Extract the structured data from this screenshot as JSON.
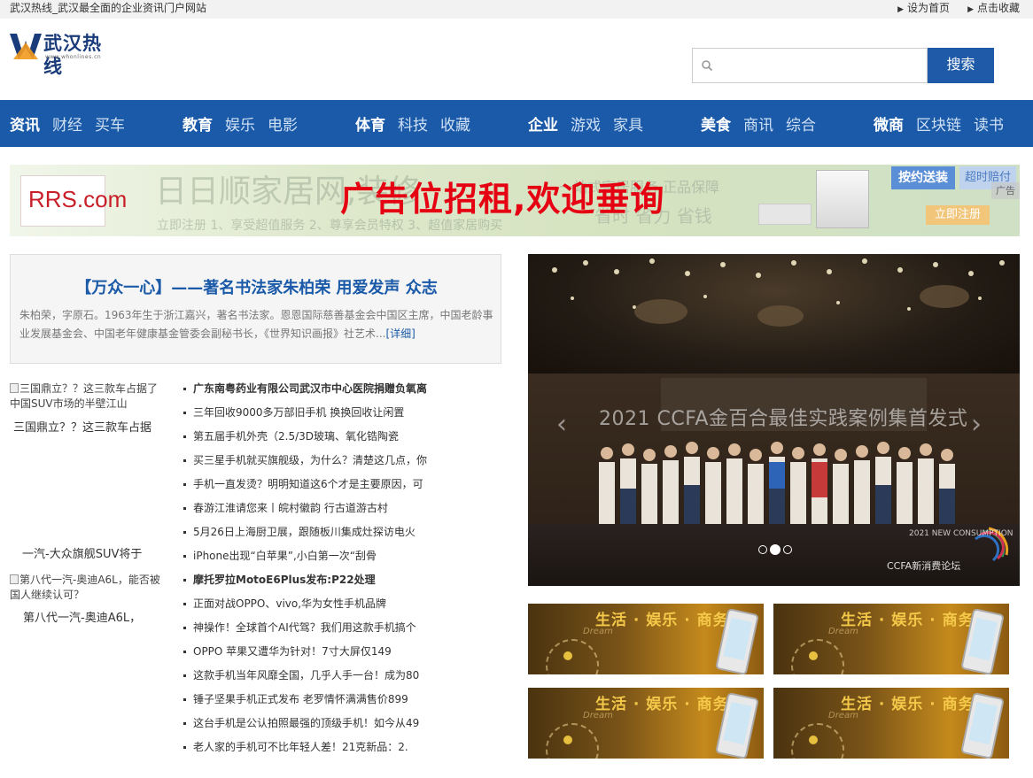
{
  "topbar": {
    "site_title": "武汉热线_武汉最全面的企业资讯门户网站",
    "set_home": "设为首页",
    "bookmark": "点击收藏"
  },
  "logo": {
    "name": "武汉热线",
    "url_text": "www.whonlines.cn"
  },
  "search": {
    "placeholder": "",
    "button": "搜索"
  },
  "nav": {
    "groups": [
      [
        "资讯",
        "财经",
        "买车"
      ],
      [
        "教育",
        "娱乐",
        "电影"
      ],
      [
        "体育",
        "科技",
        "收藏"
      ],
      [
        "企业",
        "游戏",
        "家具"
      ],
      [
        "美食",
        "商讯",
        "综合"
      ],
      [
        "微商",
        "区块链",
        "读书"
      ]
    ]
  },
  "banner": {
    "brand": "RRS.com",
    "bg_text": "日日顺家居网,装修",
    "bg_sub": "立即注册  1、享受超值服务  2、尊享会员特权  3、超值家居购买",
    "ad_text": "广告位招租,欢迎垂询",
    "slogan1": "一站式家居服务 正品保障",
    "slogan2": "省时 省力 省钱",
    "btn_install": "按约送装",
    "btn_compensate": "超时赔付",
    "btn_register": "立即注册",
    "ad_tag": "广告"
  },
  "featured": {
    "title": "【万众一心】——著名书法家朱柏荣 用爱发声 众志",
    "desc": "朱柏荣，字原石。1963年生于浙江嘉兴，著名书法家。恩恩国际慈善基金会中国区主席，中国老龄事业发展基金会、中国老年健康基金管委会副秘书长，《世界知识画报》社艺术...",
    "more": "[详细]"
  },
  "left_images": [
    {
      "alt": "三国鼎立？？这三款车占据了中国SUV市场的半壁江山",
      "caption": "三国鼎立？？这三款车占据"
    },
    {
      "alt": "",
      "caption": "一汽-大众旗舰SUV将于"
    },
    {
      "alt": "第八代一汽-奥迪A6L，能否被国人继续认可？",
      "caption": "第八代一汽-奥迪A6L，"
    }
  ],
  "news": [
    {
      "text": "广东南粤药业有限公司武汉市中心医院捐赠负氧离",
      "bold": true
    },
    {
      "text": "三年回收9000多万部旧手机 换换回收让闲置",
      "bold": false
    },
    {
      "text": "第五届手机外壳（2.5/3D玻璃、氧化锆陶瓷",
      "bold": false
    },
    {
      "text": "买三星手机就买旗舰级，为什么？清楚这几点，你",
      "bold": false
    },
    {
      "text": "手机一直发烫？明明知道这6个才是主要原因，可",
      "bold": false
    },
    {
      "text": "春游江淮请您来丨皖村徽韵 行古道游古村",
      "bold": false
    },
    {
      "text": "5月26日上海厨卫展，跟随板川集成灶探访电火",
      "bold": false
    },
    {
      "text": "iPhone出现“白苹果”,小白第一次“刮骨",
      "bold": false
    },
    {
      "text": "摩托罗拉MotoE6Plus发布:P22处理",
      "bold": true
    },
    {
      "text": "正面对战OPPO、vivo,华为女性手机品牌",
      "bold": false
    },
    {
      "text": "神操作！全球首个AI代驾？我们用这款手机搞个",
      "bold": false
    },
    {
      "text": "OPPO 苹果又遭华为针对！7寸大屏仅149",
      "bold": false
    },
    {
      "text": "这款手机当年风靡全国，几乎人手一台！成为80",
      "bold": false
    },
    {
      "text": "锤子坚果手机正式发布 老罗情怀满满售价899",
      "bold": false
    },
    {
      "text": "这台手机是公认拍照最强的顶级手机！如今从49",
      "bold": false
    },
    {
      "text": "老人家的手机可不比年轻人差！21克新品：2.",
      "bold": false
    }
  ],
  "slider": {
    "screen_text": "2021 CCFA金百合最佳实践案例集首发式",
    "forum_text": "2021 NEW CONSUMPTION FORUM",
    "forum_cn": "CCFA新消费论坛",
    "prev": "‹",
    "next": "›",
    "active_index": 2
  },
  "mini_banners": [
    {
      "text": "生活 · 娱乐 · 商务",
      "sub": "Dream"
    },
    {
      "text": "生活 · 娱乐 · 商务",
      "sub": "Dream"
    },
    {
      "text": "生活 · 娱乐 · 商务",
      "sub": "Dream"
    },
    {
      "text": "生活 · 娱乐 · 商务",
      "sub": "Dream"
    }
  ],
  "colors": {
    "nav_bg": "#1a5aa8",
    "search_btn": "#1e5aa8",
    "ad_red": "#e50012",
    "link_blue": "#1a5aa8"
  }
}
